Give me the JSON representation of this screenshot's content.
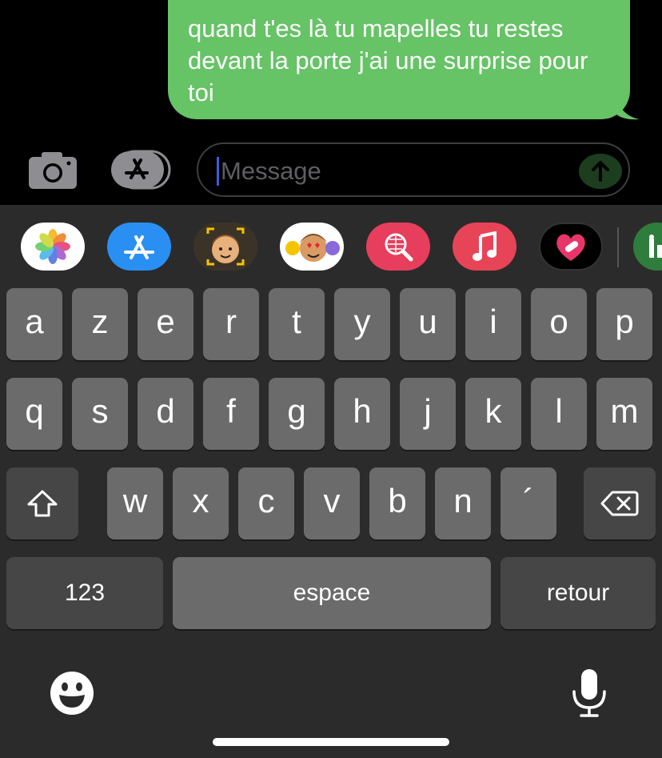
{
  "conversation": {
    "messages": [
      {
        "sender": "me",
        "text": "quand t'es là tu mapelles tu restes devant la porte j'ai une surprise pour toi"
      }
    ]
  },
  "compose": {
    "placeholder": "Message",
    "camera_icon": "camera-icon",
    "apps_icon": "app-store-icon",
    "send_icon": "arrow-up-icon"
  },
  "app_drawer": {
    "apps": [
      "photos",
      "app-store",
      "memoji",
      "memoji-stickers",
      "web-search",
      "music",
      "digital-touch",
      "more-apps"
    ]
  },
  "keyboard": {
    "rows": [
      [
        "a",
        "z",
        "e",
        "r",
        "t",
        "y",
        "u",
        "i",
        "o",
        "p"
      ],
      [
        "q",
        "s",
        "d",
        "f",
        "g",
        "h",
        "j",
        "k",
        "l",
        "m"
      ],
      [
        "w",
        "x",
        "c",
        "v",
        "b",
        "n",
        "´"
      ]
    ],
    "numbers_label": "123",
    "space_label": "espace",
    "return_label": "retour",
    "shift_icon": "shift-icon",
    "delete_icon": "backspace-icon",
    "emoji_icon": "emoji-icon",
    "dictation_icon": "microphone-icon"
  },
  "colors": {
    "bubble": "#66c366",
    "background": "#000000",
    "keyboard_bg": "#2b2b2b",
    "key": "#6b6b6b",
    "key_dark": "#464646"
  }
}
